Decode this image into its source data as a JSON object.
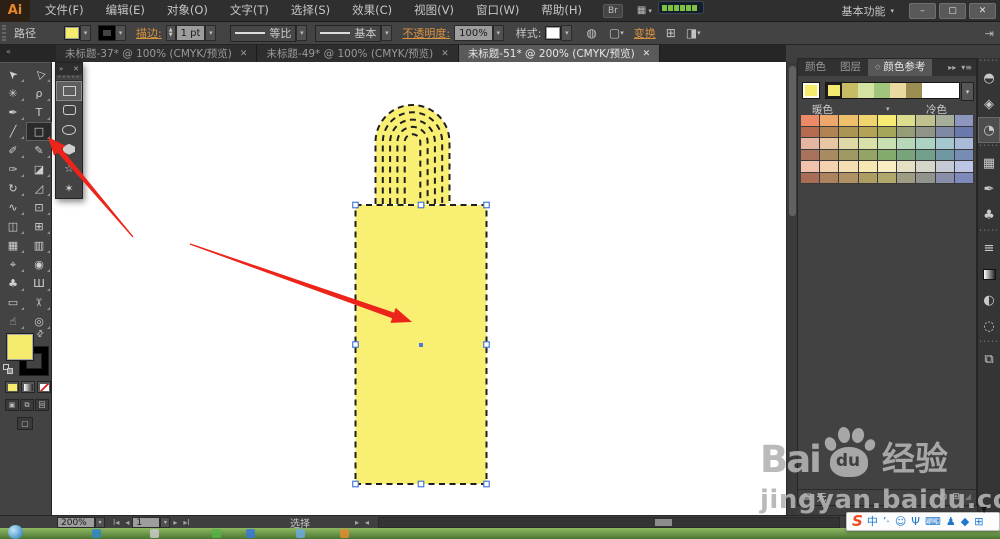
{
  "titlebar": {
    "logo": "Ai",
    "menus": [
      "文件(F)",
      "编辑(E)",
      "对象(O)",
      "文字(T)",
      "选择(S)",
      "效果(C)",
      "视图(V)",
      "窗口(W)",
      "帮助(H)"
    ],
    "br_button": "Br",
    "workspace_label": "基本功能",
    "window_buttons": {
      "minimize": "–",
      "restore": "▢",
      "close": "✕"
    }
  },
  "icons": {
    "dropdown": "▾",
    "stepper_up": "▲",
    "stepper_down": "▼",
    "swap_fill_stroke": "⇄",
    "recolor_artwork": "◍",
    "select_similar": "▢",
    "align": "⊞",
    "options": "◨",
    "collapse_control_panel": "⇥",
    "collapse_tools": "«",
    "flyout_expand": "»",
    "flyout_close": "✕",
    "panel_expand": "▸▸",
    "panel_menu": "▾≡",
    "tab_cycle": "◇",
    "first_artboard": "Ι◂",
    "prev_artboard": "◂",
    "next_artboard": "▸",
    "last_artboard": "▸Ι",
    "status_expand": "▸",
    "scroll_left": "◂",
    "scroll_down": "▼",
    "arrange_documents": "▦",
    "screen_mode": "▢",
    "drawing_normal": "▣",
    "drawing_behind": "⧉",
    "drawing_inside": "回",
    "limit_colors": "▤",
    "edit_colors": "◍",
    "save_color_group": "⊞",
    "resize_grip": "◢"
  },
  "control_bar": {
    "selection_label": "路径",
    "stroke_label": "描边:",
    "stroke_width_value": "1 pt",
    "width_profile_label": "等比",
    "brush_definition_label": "基本",
    "opacity_label": "不透明度:",
    "opacity_value": "100%",
    "style_label": "样式:",
    "transform_label": "变换"
  },
  "document_tabs": {
    "close_glyph": "✕",
    "tabs": [
      {
        "label": "未标题-37* @ 100% (CMYK/预览)",
        "active": false
      },
      {
        "label": "未标题-49* @ 100% (CMYK/预览)",
        "active": false
      },
      {
        "label": "未标题-51* @ 200% (CMYK/预览)",
        "active": true
      }
    ]
  },
  "toolbar": {
    "tools": [
      {
        "name": "selection-tool",
        "glyph": "➤",
        "rot": -135
      },
      {
        "name": "direct-selection-tool",
        "glyph": "▷",
        "rot": -135
      },
      {
        "name": "magic-wand-tool",
        "glyph": "✳",
        "rot": 0
      },
      {
        "name": "lasso-tool",
        "glyph": "ρ",
        "rot": 0
      },
      {
        "name": "pen-tool",
        "glyph": "✒",
        "rot": 0
      },
      {
        "name": "type-tool",
        "glyph": "T",
        "rot": 0
      },
      {
        "name": "line-segment-tool",
        "glyph": "╱",
        "rot": 0
      },
      {
        "name": "rectangle-tool",
        "glyph": "□",
        "rot": 0,
        "active": true
      },
      {
        "name": "paintbrush-tool",
        "glyph": "✐",
        "rot": 0
      },
      {
        "name": "pencil-tool",
        "glyph": "✎",
        "rot": 0
      },
      {
        "name": "blob-brush-tool",
        "glyph": "✑",
        "rot": 0
      },
      {
        "name": "eraser-tool",
        "glyph": "◪",
        "rot": 0
      },
      {
        "name": "rotate-tool",
        "glyph": "↻",
        "rot": 0
      },
      {
        "name": "scale-tool",
        "glyph": "◿",
        "rot": 0
      },
      {
        "name": "width-tool",
        "glyph": "∿",
        "rot": 0
      },
      {
        "name": "free-transform-tool",
        "glyph": "⊡",
        "rot": 0
      },
      {
        "name": "shape-builder-tool",
        "glyph": "◫",
        "rot": 0
      },
      {
        "name": "perspective-grid-tool",
        "glyph": "⊞",
        "rot": 0
      },
      {
        "name": "mesh-tool",
        "glyph": "▦",
        "rot": 0
      },
      {
        "name": "gradient-tool",
        "glyph": "▥",
        "rot": 0
      },
      {
        "name": "eyedropper-tool",
        "glyph": "⌖",
        "rot": 0
      },
      {
        "name": "blend-tool",
        "glyph": "◉",
        "rot": 0
      },
      {
        "name": "symbol-sprayer-tool",
        "glyph": "♣",
        "rot": 0
      },
      {
        "name": "column-graph-tool",
        "glyph": "Ш",
        "rot": 0
      },
      {
        "name": "artboard-tool",
        "glyph": "▭",
        "rot": 0
      },
      {
        "name": "slice-tool",
        "glyph": "✂",
        "rot": 90
      },
      {
        "name": "hand-tool",
        "glyph": "☝",
        "rot": 0
      },
      {
        "name": "zoom-tool",
        "glyph": "◎",
        "rot": 0
      }
    ]
  },
  "shape_flyout": {
    "tools": [
      {
        "name": "rectangle-tool",
        "shape": "rect",
        "active": true
      },
      {
        "name": "rounded-rectangle-tool",
        "shape": "rounded",
        "active": false
      },
      {
        "name": "ellipse-tool",
        "shape": "ellipse",
        "active": false
      },
      {
        "name": "polygon-tool",
        "shape": "polygon",
        "active": false
      },
      {
        "name": "star-tool",
        "shape": "glyph",
        "glyph": "☆",
        "active": false
      },
      {
        "name": "flare-tool",
        "shape": "glyph",
        "glyph": "✶",
        "active": false
      }
    ]
  },
  "color_guide_panel": {
    "tabs": [
      {
        "label": "颜色",
        "active": false
      },
      {
        "label": "图层",
        "active": false
      },
      {
        "label": "颜色参考",
        "active": true
      }
    ],
    "base_color": "#f2e96e",
    "harmony_colors": [
      "#f2e96e",
      "#c6bc66",
      "#d4e2a2",
      "#a2c57e",
      "#ead9a0",
      "#9c8d52"
    ],
    "warm_label": "暖色",
    "cool_label": "冷色",
    "none_label": "无",
    "grid": [
      [
        "#ec8a68",
        "#eea76a",
        "#efc06a",
        "#f2d46e",
        "#f6ec74",
        "#dcdd8d",
        "#bfc18f",
        "#a6ad98",
        "#8d96bf"
      ],
      [
        "#b46a4e",
        "#b08452",
        "#ac9454",
        "#b3a356",
        "#a6a658",
        "#949d76",
        "#8f9489",
        "#8089a4",
        "#6a78ad"
      ],
      [
        "#e3b5a3",
        "#e8c6a3",
        "#e0d9a5",
        "#d9e0a9",
        "#c9e0b3",
        "#b7d9b9",
        "#add3c3",
        "#a5c7cf",
        "#aabbd9"
      ],
      [
        "#a9725d",
        "#a98b61",
        "#9f9963",
        "#94a464",
        "#83ab6c",
        "#78a47b",
        "#73a08c",
        "#6f98a4",
        "#768cb5"
      ],
      [
        "#f1c3af",
        "#f4d1af",
        "#f4dfb1",
        "#f7e7b3",
        "#f9eec3",
        "#e5dfc3",
        "#d5d5c9",
        "#c5cbd5",
        "#bcc5e3"
      ],
      [
        "#a96d57",
        "#ac825f",
        "#ae9263",
        "#ae9d63",
        "#afa76b",
        "#9e9c83",
        "#93938d",
        "#898fa9",
        "#7e89bc"
      ]
    ]
  },
  "dock": {
    "sections": [
      {
        "icons": [
          {
            "name": "color-panel-icon",
            "glyph": "◓"
          },
          {
            "name": "layers-panel-icon",
            "glyph": "◈"
          },
          {
            "name": "color-guide-panel-icon",
            "glyph": "◔",
            "active": true
          }
        ]
      },
      {
        "icons": [
          {
            "name": "swatches-panel-icon",
            "glyph": "▦"
          },
          {
            "name": "brushes-panel-icon",
            "glyph": "✒"
          },
          {
            "name": "symbols-panel-icon",
            "glyph": "♣"
          }
        ]
      },
      {
        "icons": [
          {
            "name": "stroke-panel-icon",
            "glyph": "≡"
          },
          {
            "name": "gradient-panel-icon",
            "glyph": "",
            "gradient": true
          },
          {
            "name": "transparency-panel-icon",
            "glyph": "◐"
          },
          {
            "name": "appearance-panel-icon",
            "glyph": "◌"
          }
        ]
      },
      {
        "icons": [
          {
            "name": "artboards-panel-icon",
            "glyph": "⧉"
          }
        ]
      }
    ]
  },
  "status_bar": {
    "zoom_value": "200%",
    "artboard_value": "1",
    "mode_label": "选择"
  },
  "ime_bar": {
    "logo": "S",
    "icons": [
      {
        "name": "ime-chinese-icon",
        "glyph": "中"
      },
      {
        "name": "ime-punctuation-icon",
        "glyph": "’·"
      },
      {
        "name": "ime-emoji-icon",
        "glyph": "☺"
      },
      {
        "name": "ime-mic-icon",
        "glyph": "Ψ"
      },
      {
        "name": "ime-keyboard-icon",
        "glyph": "⌨"
      },
      {
        "name": "ime-account-icon",
        "glyph": "♟"
      },
      {
        "name": "ime-skin-icon",
        "glyph": "◆"
      },
      {
        "name": "ime-toolbox-icon",
        "glyph": "⊞"
      }
    ]
  },
  "watermark": {
    "bai": "Bai",
    "du": "du",
    "suffix": "经验",
    "url": "jingyan.baidu.com"
  },
  "taskbar": {
    "icons": [
      {
        "color": "#2e86c8"
      },
      {
        "color": "#c8c8c8"
      },
      {
        "color": "#55b345"
      },
      {
        "color": "#3a78d8"
      },
      {
        "color": "#6fa8e0"
      },
      {
        "color": "#e08a30"
      }
    ]
  },
  "canvas_shapes": {
    "fill": "#f8ef73",
    "dash_color": "#1f1f1f",
    "handle_stroke": "#4a79d9",
    "arrow_color": "#ec2419",
    "fill_swatch": "#f5ec6e"
  }
}
